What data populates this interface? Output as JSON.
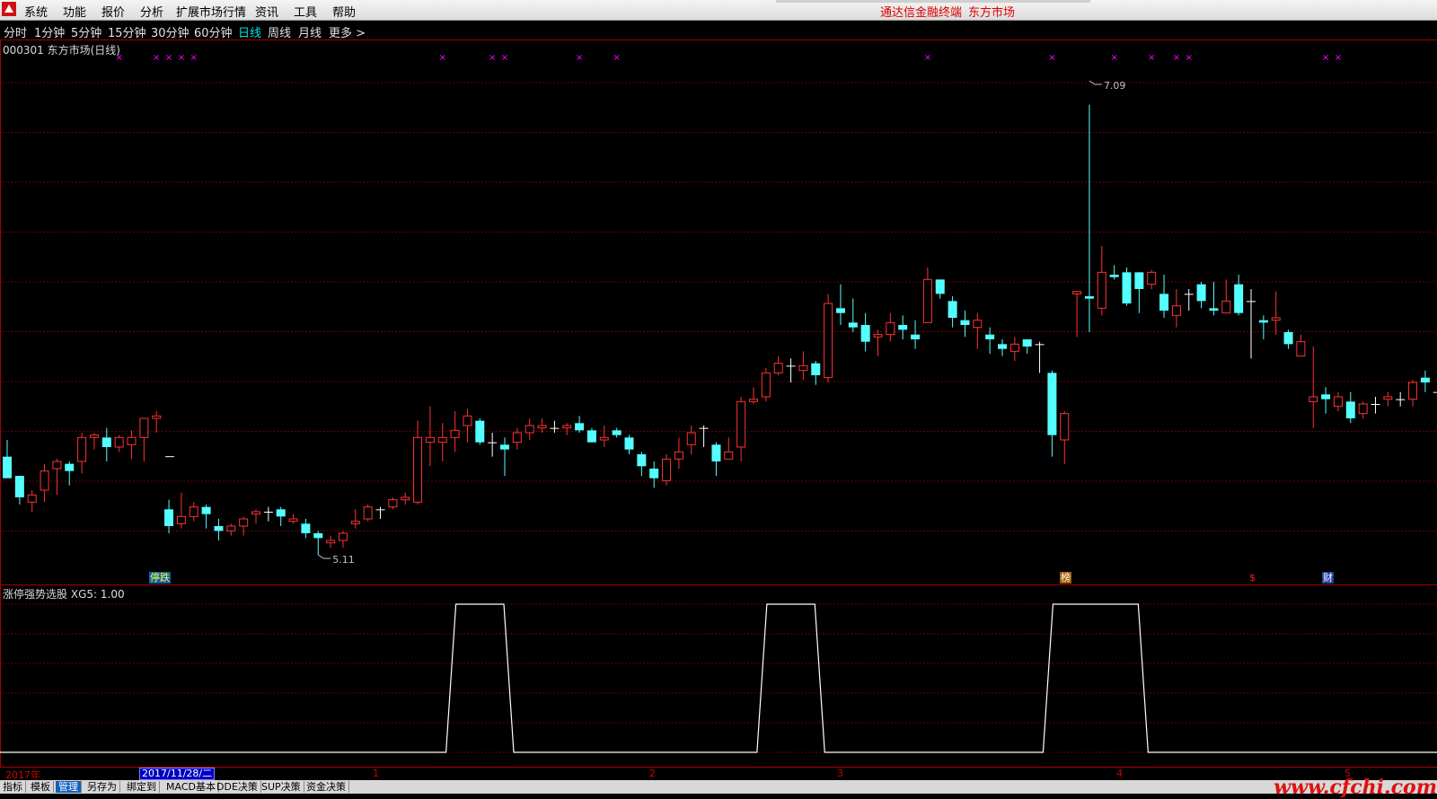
{
  "menu": {
    "items": [
      "系统",
      "功能",
      "报价",
      "分析",
      "扩展市场行情",
      "资讯",
      "工具",
      "帮助"
    ],
    "right": [
      "通达信金融终端",
      "东方市场"
    ]
  },
  "timeframes": {
    "items": [
      "分时",
      "1分钟",
      "5分钟",
      "15分钟",
      "30分钟",
      "60分钟",
      "日线",
      "周线",
      "月线",
      "更多 >"
    ],
    "active": "日线"
  },
  "chart": {
    "title": "000301 东方市场(日线)",
    "high_label": "7.09",
    "low_label": "5.11",
    "badges": [
      "停跌",
      "榜",
      "$",
      "财"
    ],
    "colors": {
      "up": "#ff3232",
      "down": "#54ffff",
      "flat": "#ffffff",
      "grid": "#700000",
      "marker": "#ff00ff"
    },
    "candles": [
      [
        5.52,
        5.43,
        5.59,
        5.43
      ],
      [
        5.44,
        5.35,
        5.44,
        5.32
      ],
      [
        5.33,
        5.36,
        5.38,
        5.29
      ],
      [
        5.38,
        5.46,
        5.49,
        5.33
      ],
      [
        5.47,
        5.5,
        5.51,
        5.36
      ],
      [
        5.49,
        5.46,
        5.5,
        5.4
      ],
      [
        5.5,
        5.6,
        5.62,
        5.45
      ],
      [
        5.6,
        5.61,
        5.62,
        5.55
      ],
      [
        5.6,
        5.56,
        5.64,
        5.5
      ],
      [
        5.56,
        5.6,
        5.61,
        5.54
      ],
      [
        5.57,
        5.6,
        5.63,
        5.51
      ],
      [
        5.6,
        5.68,
        5.68,
        5.5
      ],
      [
        5.68,
        5.69,
        5.71,
        5.62
      ],
      [
        5.3,
        5.23,
        5.34,
        5.2
      ],
      [
        5.24,
        5.27,
        5.37,
        5.22
      ],
      [
        5.27,
        5.31,
        5.33,
        5.25
      ],
      [
        5.31,
        5.28,
        5.32,
        5.22
      ],
      [
        5.23,
        5.21,
        5.26,
        5.17
      ],
      [
        5.21,
        5.23,
        5.24,
        5.19
      ],
      [
        5.23,
        5.26,
        5.27,
        5.19
      ],
      [
        5.28,
        5.29,
        5.3,
        5.24
      ],
      [
        5.29,
        5.29,
        5.31,
        5.25
      ],
      [
        5.3,
        5.27,
        5.31,
        5.23
      ],
      [
        5.25,
        5.26,
        5.28,
        5.24
      ],
      [
        5.24,
        5.2,
        5.26,
        5.18
      ],
      [
        5.2,
        5.18,
        5.21,
        5.11
      ],
      [
        5.16,
        5.17,
        5.19,
        5.14
      ],
      [
        5.17,
        5.2,
        5.21,
        5.14
      ],
      [
        5.24,
        5.25,
        5.3,
        5.22
      ],
      [
        5.26,
        5.31,
        5.32,
        5.25
      ],
      [
        5.3,
        5.3,
        5.31,
        5.26
      ],
      [
        5.31,
        5.34,
        5.35,
        5.3
      ],
      [
        5.34,
        5.35,
        5.37,
        5.32
      ],
      [
        5.33,
        5.6,
        5.67,
        5.32
      ],
      [
        5.58,
        5.6,
        5.73,
        5.48
      ],
      [
        5.58,
        5.6,
        5.66,
        5.5
      ],
      [
        5.6,
        5.63,
        5.71,
        5.54
      ],
      [
        5.65,
        5.69,
        5.72,
        5.58
      ],
      [
        5.67,
        5.58,
        5.68,
        5.57
      ],
      [
        5.58,
        5.58,
        5.62,
        5.52
      ],
      [
        5.57,
        5.55,
        5.6,
        5.44
      ],
      [
        5.58,
        5.62,
        5.64,
        5.55
      ],
      [
        5.62,
        5.65,
        5.68,
        5.59
      ],
      [
        5.64,
        5.65,
        5.68,
        5.62
      ],
      [
        5.64,
        5.64,
        5.67,
        5.62
      ],
      [
        5.64,
        5.65,
        5.66,
        5.61
      ],
      [
        5.66,
        5.63,
        5.69,
        5.62
      ],
      [
        5.63,
        5.58,
        5.64,
        5.58
      ],
      [
        5.59,
        5.6,
        5.65,
        5.56
      ],
      [
        5.63,
        5.61,
        5.64,
        5.6
      ],
      [
        5.6,
        5.55,
        5.61,
        5.53
      ],
      [
        5.53,
        5.48,
        5.54,
        5.44
      ],
      [
        5.47,
        5.43,
        5.5,
        5.39
      ],
      [
        5.42,
        5.51,
        5.53,
        5.4
      ],
      [
        5.51,
        5.54,
        5.6,
        5.47
      ],
      [
        5.57,
        5.62,
        5.65,
        5.53
      ],
      [
        5.64,
        5.64,
        5.65,
        5.56
      ],
      [
        5.57,
        5.5,
        5.58,
        5.44
      ],
      [
        5.51,
        5.54,
        5.6,
        5.52
      ],
      [
        5.56,
        5.75,
        5.77,
        5.5
      ],
      [
        5.75,
        5.76,
        5.81,
        5.74
      ],
      [
        5.77,
        5.87,
        5.89,
        5.75
      ],
      [
        5.87,
        5.91,
        5.94,
        5.86
      ],
      [
        5.9,
        5.9,
        5.93,
        5.83
      ],
      [
        5.88,
        5.9,
        5.96,
        5.84
      ],
      [
        5.91,
        5.86,
        5.92,
        5.82
      ],
      [
        5.85,
        6.16,
        6.2,
        5.83
      ],
      [
        6.14,
        6.12,
        6.24,
        6.07
      ],
      [
        6.08,
        6.06,
        6.18,
        6.04
      ],
      [
        6.07,
        6.0,
        6.12,
        5.96
      ],
      [
        6.02,
        6.03,
        6.05,
        5.94
      ],
      [
        6.03,
        6.08,
        6.12,
        6.0
      ],
      [
        6.07,
        6.05,
        6.11,
        6.01
      ],
      [
        6.03,
        6.01,
        6.09,
        5.97
      ],
      [
        6.08,
        6.26,
        6.31,
        6.09
      ],
      [
        6.26,
        6.2,
        6.26,
        6.18
      ],
      [
        6.17,
        6.1,
        6.19,
        6.06
      ],
      [
        6.09,
        6.07,
        6.13,
        6.02
      ],
      [
        6.06,
        6.09,
        6.12,
        5.97
      ],
      [
        6.03,
        6.01,
        6.06,
        5.95
      ],
      [
        5.99,
        5.97,
        6.01,
        5.94
      ],
      [
        5.96,
        5.99,
        6.02,
        5.92
      ],
      [
        6.01,
        5.98,
        6.01,
        5.95
      ],
      [
        5.99,
        5.99,
        6.0,
        5.87
      ],
      [
        5.87,
        5.61,
        5.88,
        5.52
      ],
      [
        5.59,
        5.7,
        5.71,
        5.49
      ],
      [
        6.2,
        6.21,
        6.21,
        6.02
      ],
      [
        6.19,
        6.18,
        6.99,
        6.04
      ],
      [
        6.14,
        6.29,
        6.4,
        6.11
      ],
      [
        6.28,
        6.27,
        6.32,
        6.26
      ],
      [
        6.29,
        6.16,
        6.31,
        6.15
      ],
      [
        6.29,
        6.22,
        6.29,
        6.12
      ],
      [
        6.24,
        6.29,
        6.3,
        6.22
      ],
      [
        6.2,
        6.13,
        6.28,
        6.1
      ],
      [
        6.11,
        6.15,
        6.22,
        6.06
      ],
      [
        6.2,
        6.2,
        6.22,
        6.13
      ],
      [
        6.24,
        6.17,
        6.25,
        6.14
      ],
      [
        6.14,
        6.13,
        6.25,
        6.11
      ],
      [
        6.12,
        6.17,
        6.26,
        6.12
      ],
      [
        6.24,
        6.12,
        6.28,
        6.11
      ],
      [
        6.17,
        6.17,
        6.22,
        5.93
      ],
      [
        6.09,
        6.08,
        6.11,
        6.01
      ],
      [
        6.09,
        6.1,
        6.21,
        6.03
      ],
      [
        6.04,
        5.99,
        6.05,
        5.97
      ],
      [
        5.94,
        6.0,
        6.03,
        5.97
      ],
      [
        5.75,
        5.77,
        5.98,
        5.64
      ],
      [
        5.78,
        5.76,
        5.81,
        5.7
      ],
      [
        5.73,
        5.77,
        5.79,
        5.71
      ],
      [
        5.75,
        5.68,
        5.79,
        5.66
      ],
      [
        5.7,
        5.74,
        5.75,
        5.68
      ],
      [
        5.74,
        5.74,
        5.77,
        5.7
      ],
      [
        5.76,
        5.77,
        5.79,
        5.73
      ],
      [
        5.76,
        5.76,
        5.79,
        5.73
      ],
      [
        5.76,
        5.83,
        5.84,
        5.73
      ],
      [
        5.85,
        5.83,
        5.88,
        5.79
      ],
      [
        5.79,
        5.79,
        5.82,
        5.76
      ]
    ],
    "markers": [
      9,
      12,
      13,
      14,
      15,
      35,
      39,
      40,
      46,
      49,
      74,
      84,
      89,
      92,
      94,
      95,
      106,
      107
    ],
    "stop_label_index": 12
  },
  "indicator": {
    "title": "涨停强势选股",
    "key": "XG5:",
    "value": "1.00",
    "pulses": [
      [
        36,
        40
      ],
      [
        61,
        65
      ],
      [
        84,
        91
      ]
    ]
  },
  "dates": {
    "year": "2017年",
    "selected": "2017/11/28/二",
    "months": [
      "1",
      "2",
      "3",
      "4",
      "5"
    ]
  },
  "tabs": {
    "items": [
      "指标",
      "模板",
      "管理",
      "另存为",
      "绑定到",
      "MACD基本",
      "DDE决策",
      "SUP决策",
      "资金决策"
    ],
    "active": "管理"
  },
  "watermark": "www.cfchi.com"
}
